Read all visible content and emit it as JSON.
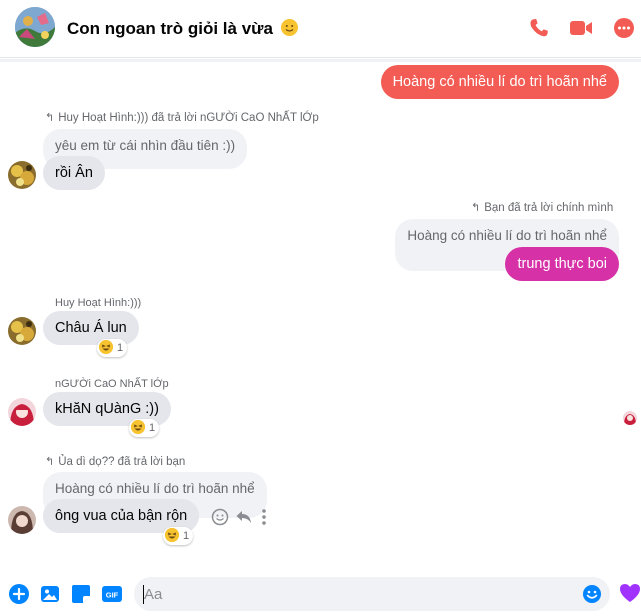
{
  "header": {
    "title": "Con ngoan trò giỏi là vừa",
    "title_emoji": "smiling-face-emoji",
    "accent_color": "#f25c54",
    "icons": [
      "phone-icon",
      "video-camera-icon",
      "more-options-icon"
    ]
  },
  "messages": [
    {
      "type": "outgoing",
      "text": "Hoàng có nhiều lí do trì hoãn nhể",
      "color": "#f25c54"
    },
    {
      "type": "reply_meta",
      "text": "Huy Hoạt Hình:))) đã trả lời nGƯỜi CaO NhẤT lỚp"
    },
    {
      "type": "incoming_quote",
      "text": "yêu em từ cái nhìn đầu tiên :))"
    },
    {
      "type": "incoming",
      "text": "rồi Ân",
      "avatar": "avatar-huy"
    },
    {
      "type": "reply_meta_out",
      "text": "Bạn đã trả lời chính mình"
    },
    {
      "type": "outgoing_quote",
      "text": "Hoàng có nhiều lí do trì hoãn nhể"
    },
    {
      "type": "outgoing",
      "text": "trung thực boi",
      "color": "#d631a6"
    },
    {
      "type": "sender",
      "text": "Huy Hoạt Hình:)))"
    },
    {
      "type": "incoming",
      "text": "Châu Á lun",
      "reaction": {
        "emoji": "laughing-face",
        "count": "1"
      }
    },
    {
      "type": "sender",
      "text": "nGƯỜi CaO NhẤT lỚp"
    },
    {
      "type": "incoming",
      "text": "kHăN qUànG :))",
      "reaction": {
        "emoji": "laughing-face",
        "count": "1"
      }
    },
    {
      "type": "reply_meta",
      "text": "Ủa dì dọ?? đã trả lời bạn"
    },
    {
      "type": "incoming_quote",
      "text": "Hoàng có nhiều lí do trì hoãn nhể"
    },
    {
      "type": "incoming",
      "text": "ông vua của bận rộn",
      "reaction": {
        "emoji": "laughing-face",
        "count": "1"
      }
    }
  ],
  "composer": {
    "placeholder": "Aa",
    "icons": [
      "plus-icon",
      "image-icon",
      "sticker-icon",
      "gif-icon",
      "emoji-icon",
      "heart-icon"
    ],
    "gif_label": "GIF"
  }
}
